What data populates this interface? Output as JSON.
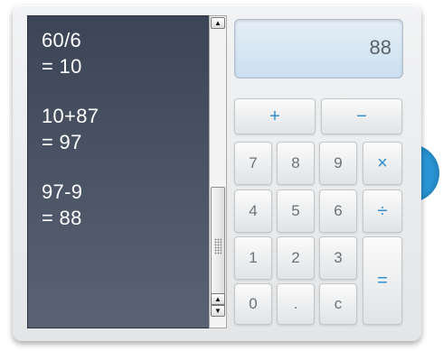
{
  "history": [
    {
      "expression": "60/6",
      "result": "= 10"
    },
    {
      "expression": "10+87",
      "result": "= 97"
    },
    {
      "expression": "97-9",
      "result": "= 88"
    }
  ],
  "scrollbar": {
    "up_icon": "▲",
    "down_icons": [
      "▲",
      "▼"
    ]
  },
  "display": {
    "value": "88"
  },
  "keys": {
    "plus": "+",
    "minus": "−",
    "seven": "7",
    "eight": "8",
    "nine": "9",
    "multiply": "×",
    "four": "4",
    "five": "5",
    "six": "6",
    "divide": "÷",
    "one": "1",
    "two": "2",
    "three": "3",
    "equals": "=",
    "zero": "0",
    "decimal": ".",
    "clear": "c"
  },
  "colors": {
    "accent": "#2f8fd1",
    "history_bg": "#3b4556",
    "side_tab": "#2a95d6"
  }
}
